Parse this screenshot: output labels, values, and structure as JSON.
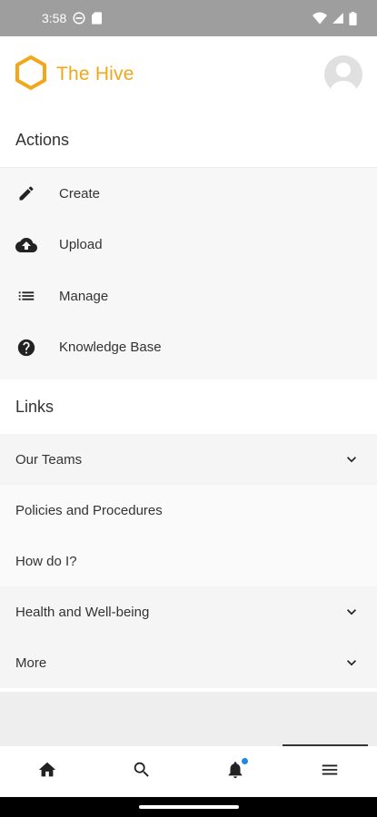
{
  "status_bar": {
    "time": "3:58"
  },
  "app": {
    "title": "The Hive",
    "accent_color": "#f2a71b"
  },
  "actions": {
    "heading": "Actions",
    "items": [
      {
        "label": "Create",
        "icon": "pencil-icon"
      },
      {
        "label": "Upload",
        "icon": "cloud-upload-icon"
      },
      {
        "label": "Manage",
        "icon": "list-icon"
      },
      {
        "label": "Knowledge Base",
        "icon": "help-circle-icon"
      }
    ]
  },
  "links": {
    "heading": "Links",
    "items": [
      {
        "label": "Our Teams",
        "expandable": true
      },
      {
        "label": "Policies and Procedures",
        "expandable": false
      },
      {
        "label": "How do I?",
        "expandable": false
      },
      {
        "label": "Health and Well-being",
        "expandable": true
      },
      {
        "label": "More",
        "expandable": true
      }
    ]
  },
  "bottom_nav": {
    "items": [
      {
        "icon": "home-icon"
      },
      {
        "icon": "search-icon"
      },
      {
        "icon": "bell-icon",
        "badge": true,
        "badge_color": "#1e88e5"
      },
      {
        "icon": "menu-icon",
        "active": true
      }
    ]
  }
}
